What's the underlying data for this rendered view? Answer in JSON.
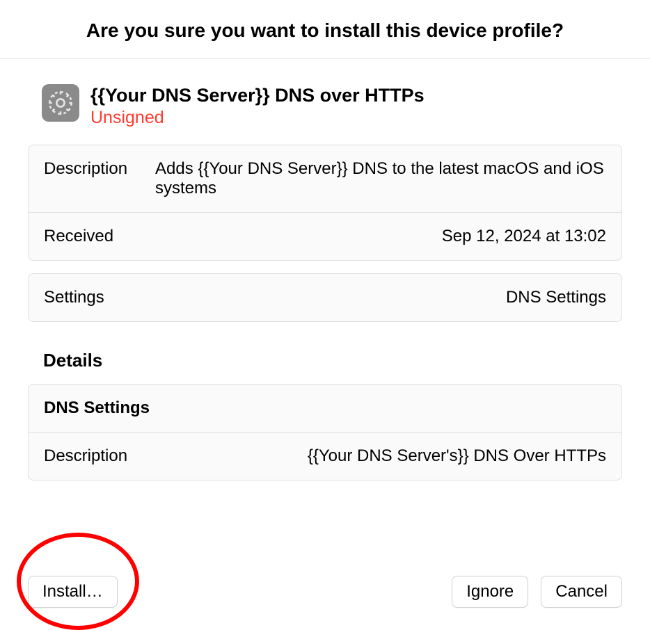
{
  "header": {
    "title": "Are you sure you want to install this device profile?"
  },
  "profile": {
    "title": "{{Your DNS Server}} DNS over HTTPs",
    "signed_status": "Unsigned"
  },
  "info": {
    "description_label": "Description",
    "description_value": "Adds {{Your DNS Server}} DNS to the latest macOS and iOS systems",
    "received_label": "Received",
    "received_value": "Sep 12, 2024 at 13:02",
    "settings_label": "Settings",
    "settings_value": "DNS Settings"
  },
  "details": {
    "heading": "Details",
    "section_title": "DNS Settings",
    "description_label": "Description",
    "description_value": "{{Your DNS Server's}} DNS Over HTTPs"
  },
  "buttons": {
    "install": "Install…",
    "ignore": "Ignore",
    "cancel": "Cancel"
  }
}
